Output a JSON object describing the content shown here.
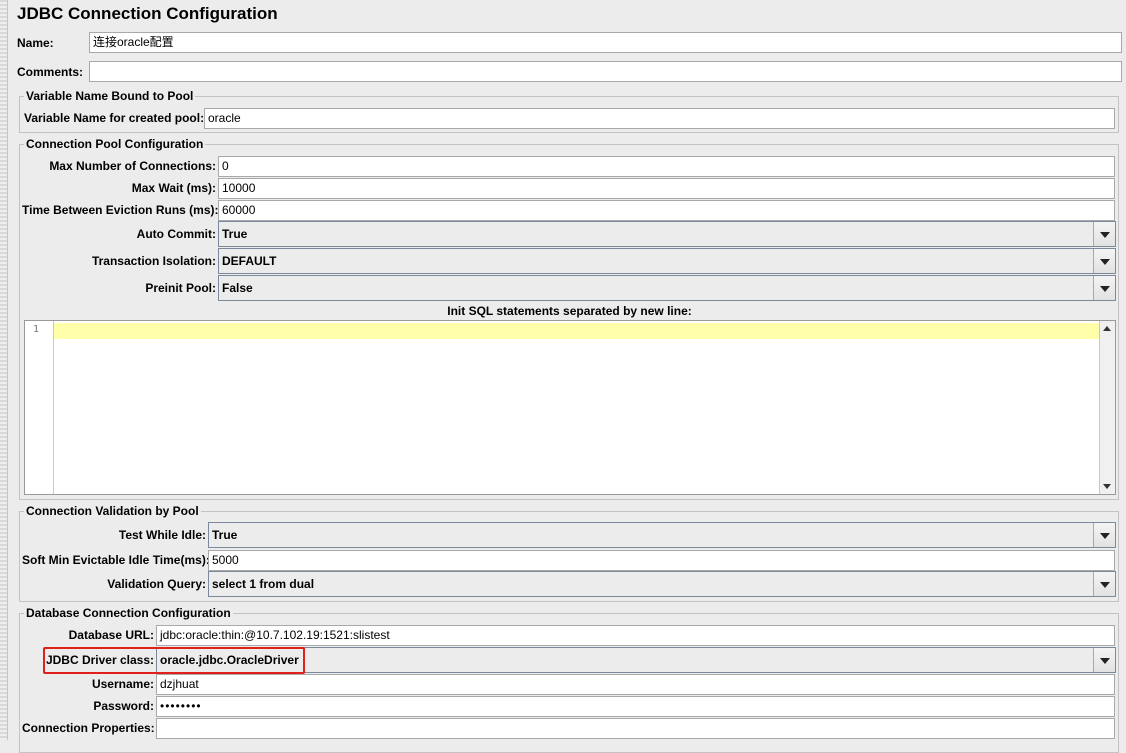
{
  "title": "JDBC Connection Configuration",
  "name": {
    "label": "Name:",
    "value": "连接oracle配置"
  },
  "comments": {
    "label": "Comments:",
    "value": ""
  },
  "variable_group": {
    "legend": "Variable Name Bound to Pool",
    "label": "Variable Name for created pool:",
    "value": "oracle"
  },
  "pool_group": {
    "legend": "Connection Pool Configuration",
    "max_connections": {
      "label": "Max Number of Connections:",
      "value": "0"
    },
    "max_wait": {
      "label": "Max Wait (ms):",
      "value": "10000"
    },
    "eviction": {
      "label": "Time Between Eviction Runs (ms):",
      "value": "60000"
    },
    "auto_commit": {
      "label": "Auto Commit:",
      "value": "True"
    },
    "transaction_isolation": {
      "label": "Transaction Isolation:",
      "value": "DEFAULT"
    },
    "preinit_pool": {
      "label": "Preinit Pool:",
      "value": "False"
    },
    "init_sql": {
      "label": "Init SQL statements separated by new line:",
      "line_number": "1"
    }
  },
  "validation_group": {
    "legend": "Connection Validation by Pool",
    "test_while_idle": {
      "label": "Test While Idle:",
      "value": "True"
    },
    "soft_min": {
      "label": "Soft Min Evictable Idle Time(ms):",
      "value": "5000"
    },
    "validation_query": {
      "label": "Validation Query:",
      "value": "select 1 from dual"
    }
  },
  "database_group": {
    "legend": "Database Connection Configuration",
    "url": {
      "label": "Database URL:",
      "value": "jdbc:oracle:thin:@10.7.102.19:1521:slistest"
    },
    "driver": {
      "label": "JDBC Driver class:",
      "value": "oracle.jdbc.OracleDriver"
    },
    "username": {
      "label": "Username:",
      "value": "dzjhuat"
    },
    "password": {
      "label": "Password:",
      "value": "••••••••"
    },
    "properties": {
      "label": "Connection Properties:",
      "value": ""
    }
  },
  "colors": {
    "highlight": "#e0201a",
    "current_line": "#ffffaa",
    "background": "#ececec"
  },
  "icons": {
    "dropdown": "chevron-down-icon"
  }
}
